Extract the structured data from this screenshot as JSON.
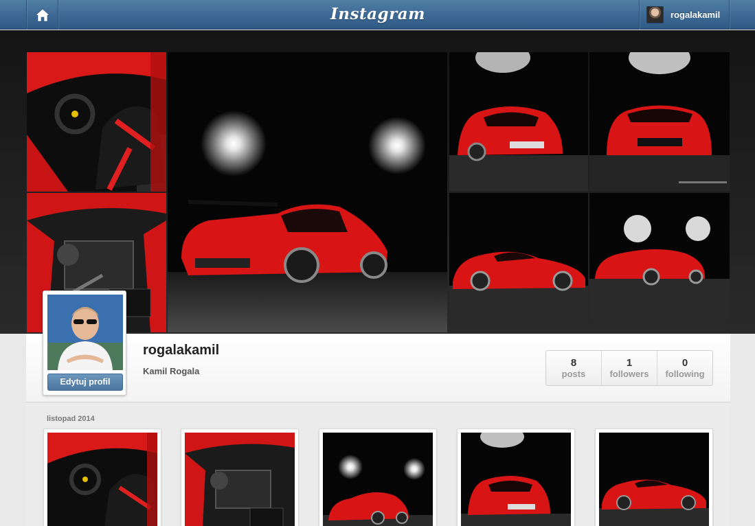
{
  "topbar": {
    "brand": "Instagram",
    "home_icon": "home-icon",
    "username": "rogalakamil"
  },
  "profile": {
    "username": "rogalakamil",
    "full_name": "Kamil Rogala",
    "edit_button": "Edytuj profil",
    "stats": [
      {
        "value": "8",
        "label": "posts"
      },
      {
        "value": "1",
        "label": "followers"
      },
      {
        "value": "0",
        "label": "following"
      }
    ]
  },
  "feed": {
    "month_label": "listopad 2014"
  },
  "colors": {
    "topbar": "#3c6893",
    "accent_button": "#4a76a0",
    "car_red": "#d81414"
  }
}
